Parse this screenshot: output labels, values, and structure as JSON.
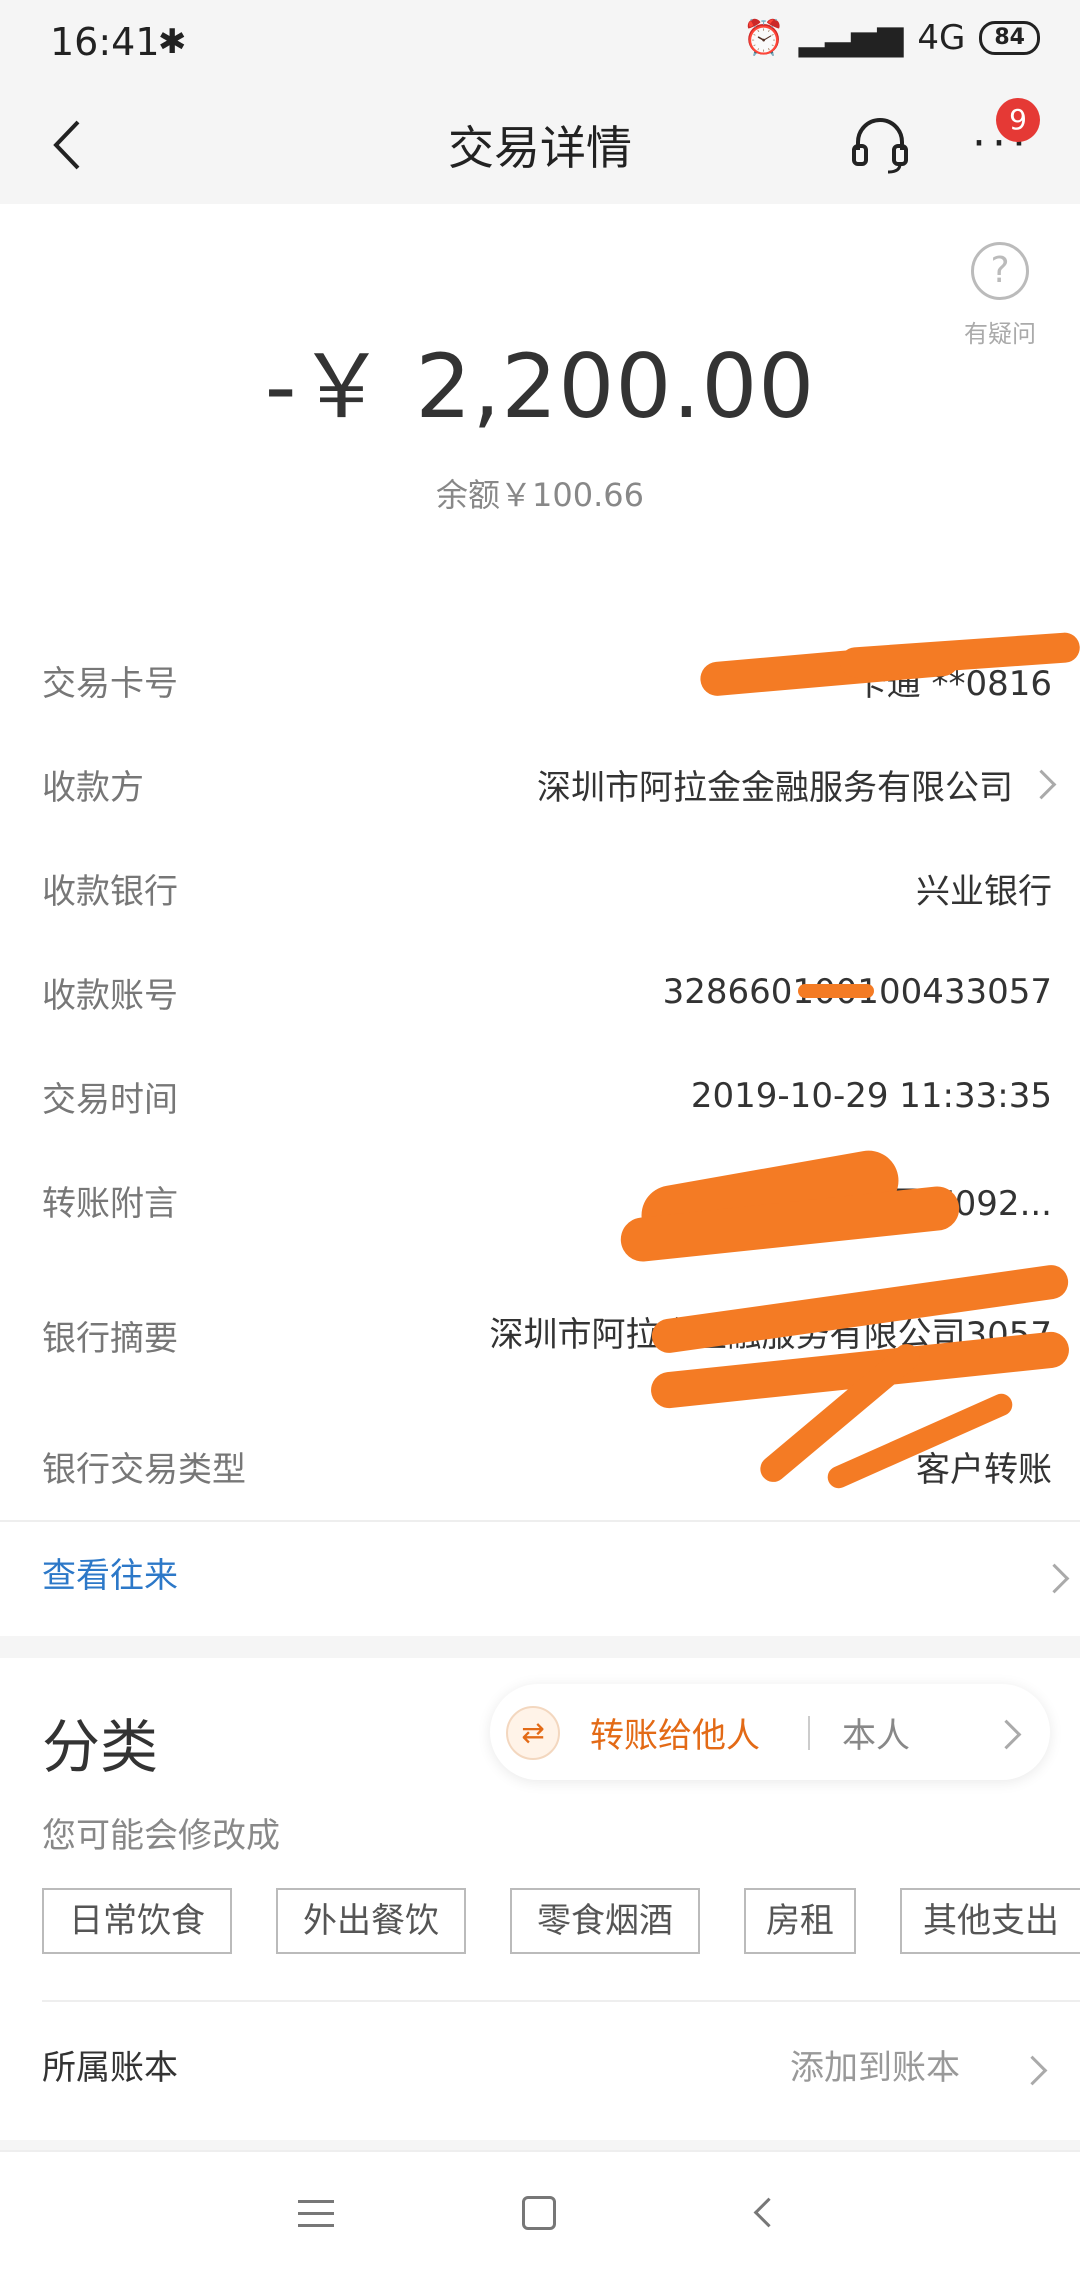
{
  "status_bar": {
    "time": "16:41",
    "network": "4G",
    "battery": "84"
  },
  "header": {
    "title": "交易详情",
    "notification_count": "9"
  },
  "help": {
    "label": "有疑问"
  },
  "summary": {
    "amount": "-￥ 2,200.00",
    "balance": "余额￥100.66"
  },
  "details": [
    {
      "label": "交易卡号",
      "value": "一卡通 **0816"
    },
    {
      "label": "收款方",
      "value": "深圳市阿拉金金融服务有限公司"
    },
    {
      "label": "收款银行",
      "value": "兴业银行"
    },
    {
      "label": "收款账号",
      "value": "328660100100433057"
    },
    {
      "label": "交易时间",
      "value": "2019-10-29 11:33:35"
    },
    {
      "label": "转账附言",
      "value": "王 7092..."
    },
    {
      "label": "银行摘要",
      "value": "深圳市阿拉金金融服务有限公司3057"
    },
    {
      "label": "银行交易类型",
      "value": "客户转账"
    }
  ],
  "view_history": {
    "label": "查看往来"
  },
  "category": {
    "title": "分类",
    "current": "转账给他人",
    "alternative": "本人",
    "hint": "您可能会修改成",
    "tags": [
      "日常饮食",
      "外出餐饮",
      "零食烟酒",
      "房租",
      "其他支出"
    ]
  },
  "ledger": {
    "label": "所属账本",
    "action": "添加到账本"
  },
  "colors": {
    "accent_orange": "#e36a16",
    "link_blue": "#2c78c8",
    "badge_red": "#e53935",
    "redaction": "#f47b24"
  }
}
